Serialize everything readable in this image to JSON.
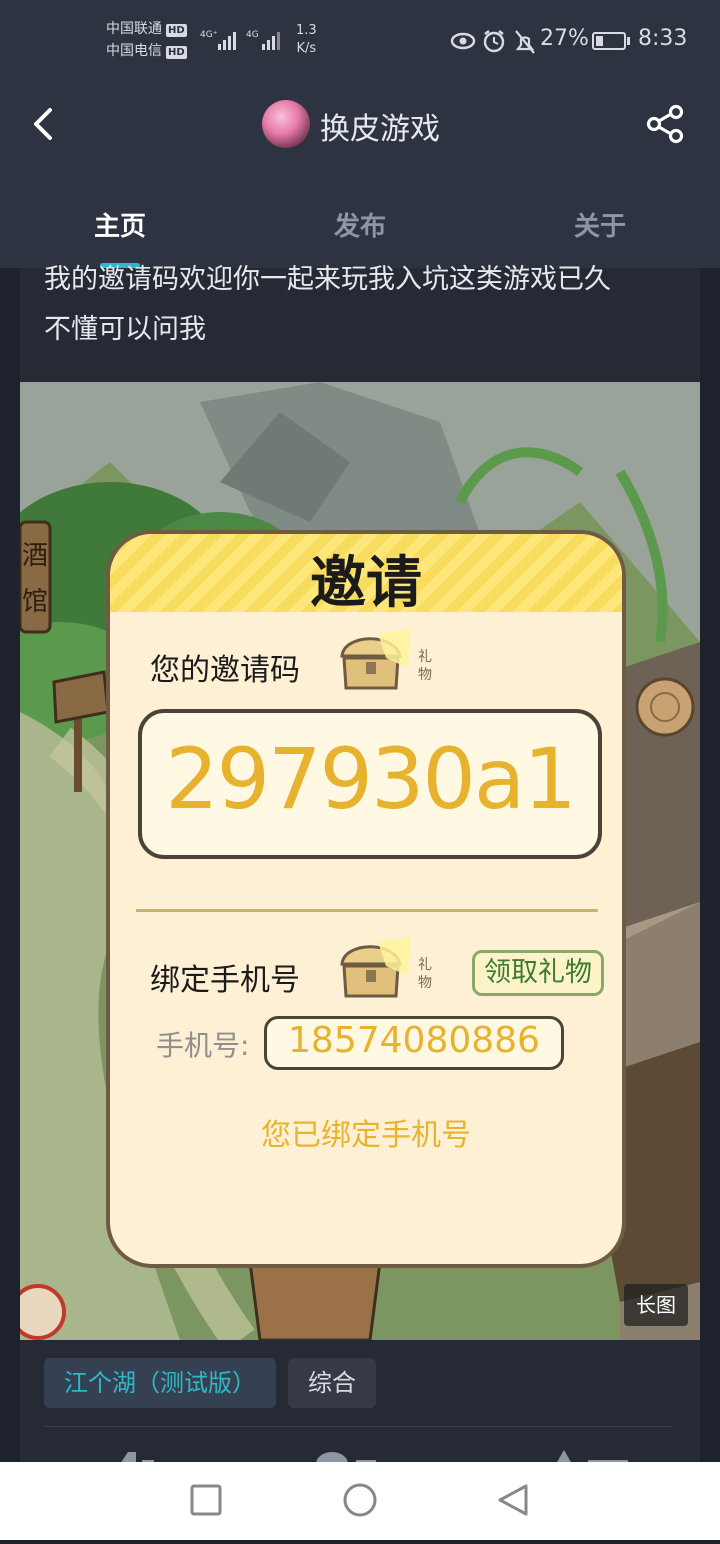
{
  "status": {
    "carrier1": "中国联通",
    "carrier2": "中国电信",
    "hd": "HD",
    "net1": "4G⁺",
    "net2": "4G",
    "speed_value": "1.3",
    "speed_unit": "K/s",
    "battery": "27%",
    "battery_level": 0.27,
    "time": "8:33"
  },
  "header": {
    "title": "换皮游戏"
  },
  "tabs": [
    {
      "label": "主页"
    },
    {
      "label": "发布"
    },
    {
      "label": "关于"
    }
  ],
  "post": {
    "text": "我的邀请码欢迎你一起来玩我入坑这类游戏已久\n不懂可以问我",
    "long_image_label": "长图"
  },
  "invite": {
    "title": "邀请",
    "your_code_label": "您的邀请码",
    "gift_label": "礼物",
    "code": "297930a1",
    "bind_phone_label": "绑定手机号",
    "claim_button": "领取礼物",
    "phone_label": "手机号:",
    "phone": "18574080886",
    "bound_message": "您已绑定手机号"
  },
  "game_signs": {
    "tavern": "酒馆"
  },
  "tags": [
    {
      "label": "江个湖（测试版）"
    },
    {
      "label": "综合"
    }
  ],
  "colors": {
    "accent": "#2fb8c7",
    "code": "#e7b22d",
    "panel": "#fdf0d4",
    "panel_header": "#fde67a"
  }
}
